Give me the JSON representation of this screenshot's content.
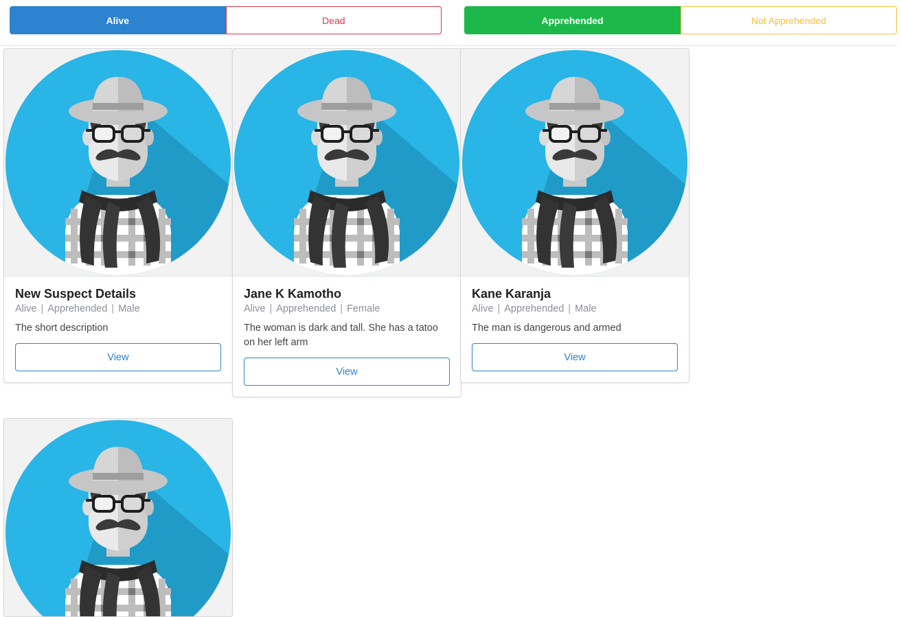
{
  "filters": {
    "status": {
      "alive": "Alive",
      "dead": "Dead"
    },
    "apprehension": {
      "apprehended": "Apprehended",
      "not_apprehended": "Not Apprehended"
    }
  },
  "colors": {
    "primary": "#2d83cf",
    "danger": "#dc3545",
    "success": "#1cb94a",
    "warning": "#f5c036",
    "avatar_bg": "#29b5e6"
  },
  "cards": [
    {
      "name": "New Suspect Details",
      "status": "Alive",
      "apprehension": "Apprehended",
      "gender": "Male",
      "description": "The short description",
      "button": "View",
      "avatar_icon": "suspect-avatar-icon"
    },
    {
      "name": "Jane K Kamotho",
      "status": "Alive",
      "apprehension": "Apprehended",
      "gender": "Female",
      "description": "The woman is dark and tall. She has a tatoo on her left arm",
      "button": "View",
      "avatar_icon": "suspect-avatar-icon"
    },
    {
      "name": "Kane Karanja",
      "status": "Alive",
      "apprehension": "Apprehended",
      "gender": "Male",
      "description": "The man is dangerous and armed",
      "button": "View",
      "avatar_icon": "suspect-avatar-icon"
    },
    {
      "avatar_icon": "suspect-avatar-icon"
    }
  ]
}
